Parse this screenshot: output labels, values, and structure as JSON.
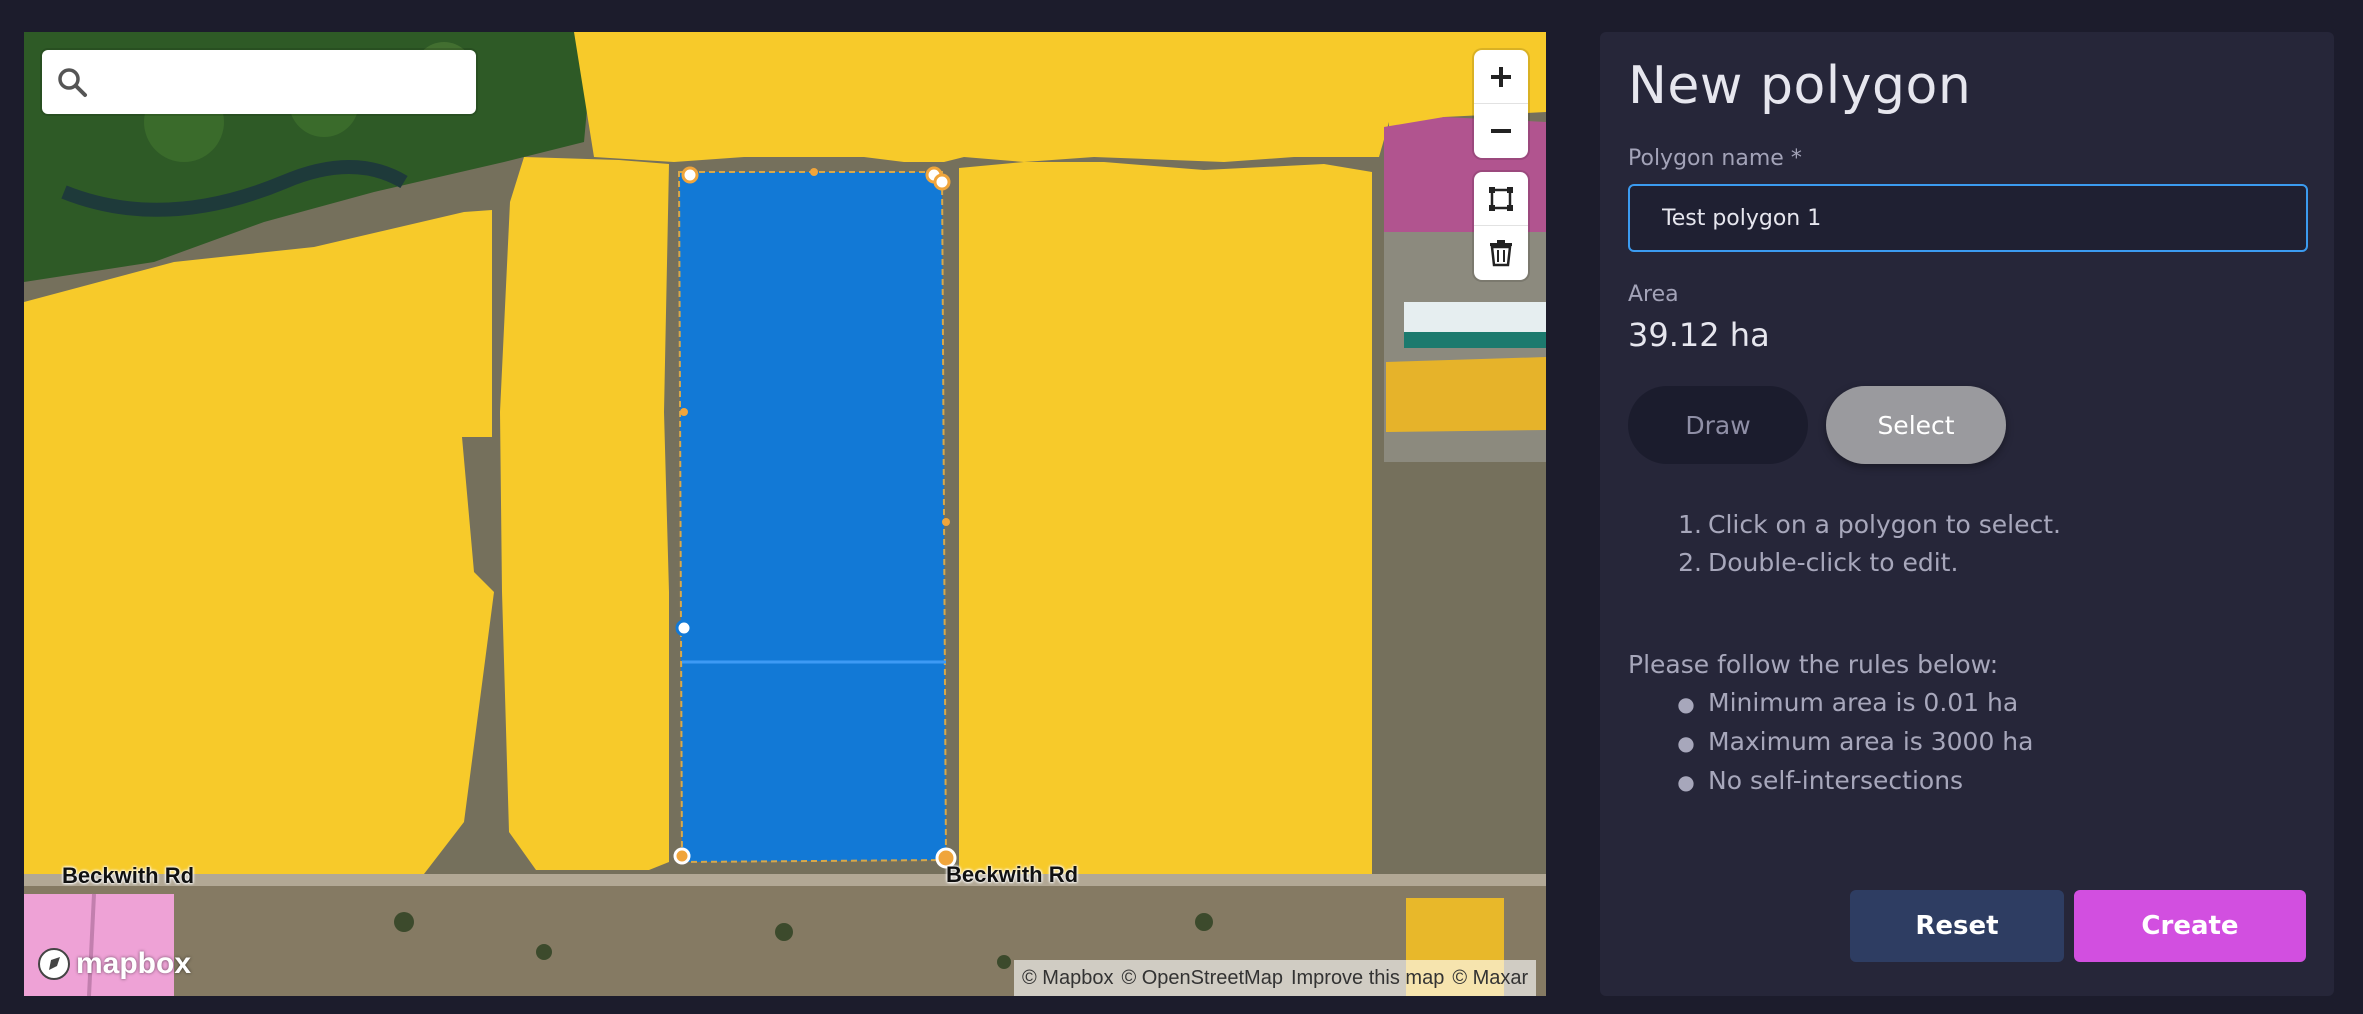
{
  "search": {
    "placeholder": "",
    "value": ""
  },
  "map": {
    "road_labels": [
      "Beckwith Rd",
      "Beckwith Rd"
    ],
    "logo_text": "mapbox",
    "attribution": [
      "© Mapbox",
      "© OpenStreetMap",
      "Improve this map",
      "© Maxar"
    ],
    "controls": [
      "zoom-in-icon",
      "zoom-out-icon",
      "polygon-tool-icon",
      "trash-icon"
    ],
    "colors": {
      "field": "#f7ca2a",
      "selected_polygon": "#1279d6",
      "magenta_field": "#b1548f",
      "pink_field": "#eea2d6"
    }
  },
  "panel": {
    "title": "New polygon",
    "name_label": "Polygon name *",
    "name_value": "Test polygon 1",
    "area_label": "Area",
    "area_value": "39.12 ha",
    "draw_label": "Draw",
    "select_label": "Select",
    "active_mode": "Select",
    "instructions": [
      {
        "num": "1.",
        "text": "Click on a polygon to select."
      },
      {
        "num": "2.",
        "text": "Double-click to edit."
      }
    ],
    "rules_heading": "Please follow the rules below:",
    "rules": [
      "Minimum area is 0.01 ha",
      "Maximum area is 3000 ha",
      "No self-intersections"
    ],
    "reset_label": "Reset",
    "create_label": "Create",
    "colors": {
      "create": "#d24fe0",
      "reset": "#2e3d62",
      "input_border": "#3b9bf0"
    }
  }
}
